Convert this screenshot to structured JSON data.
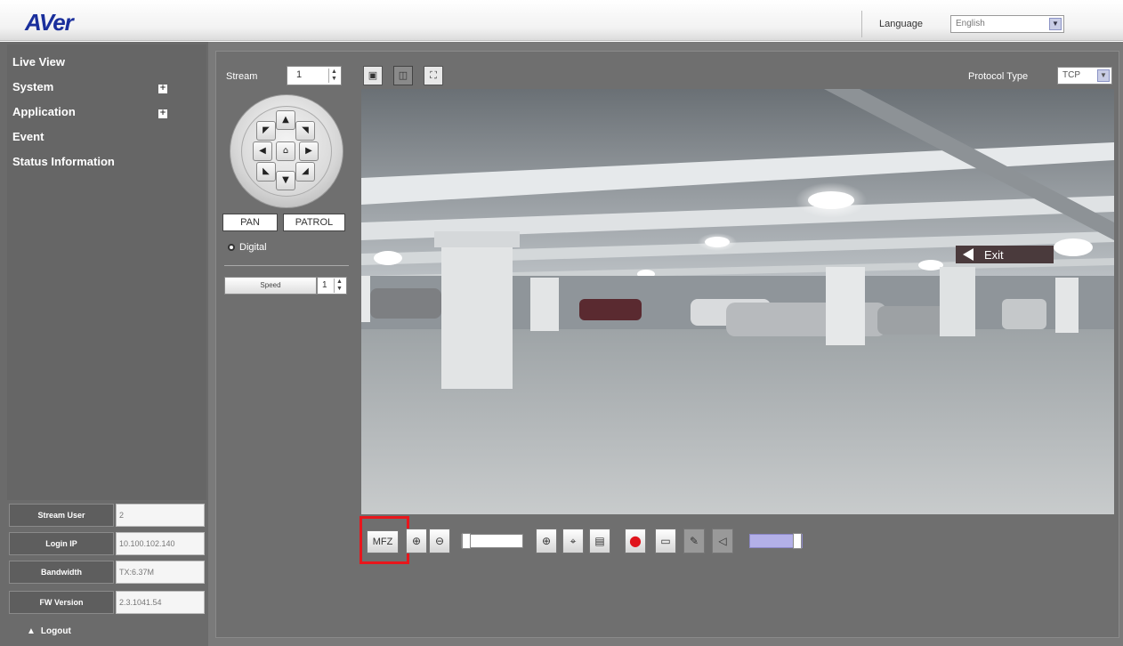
{
  "header": {
    "logo": "AVer",
    "language_label": "Language",
    "language_value": "English"
  },
  "sidebar": {
    "menu": [
      {
        "label": "Live View",
        "has_plus": false
      },
      {
        "label": "System",
        "has_plus": true
      },
      {
        "label": "Application",
        "has_plus": true
      },
      {
        "label": "Event",
        "has_plus": false
      },
      {
        "label": "Status Information",
        "has_plus": false
      }
    ],
    "info": [
      {
        "label": "Stream User",
        "value": "2"
      },
      {
        "label": "Login IP",
        "value": "10.100.102.140"
      },
      {
        "label": "Bandwidth",
        "value": "TX:6.37M"
      },
      {
        "label": "FW Version",
        "value": "2.3.1041.54"
      }
    ],
    "logout": "Logout"
  },
  "ptz": {
    "stream_label": "Stream",
    "stream_value": "1",
    "pan_label": "PAN",
    "patrol_label": "PATROL",
    "digital_label": "Digital",
    "speed_label": "Speed",
    "speed_value": "1"
  },
  "video": {
    "protocol_label": "Protocol Type",
    "protocol_value": "TCP",
    "exit_sign": "Exit"
  },
  "toolbar": {
    "mfz_label": "MFZ"
  },
  "colors": {
    "logo": "#1a2f9c",
    "highlight": "#e8161c",
    "sidebar": "#666666",
    "main": "#7a7a7a"
  }
}
